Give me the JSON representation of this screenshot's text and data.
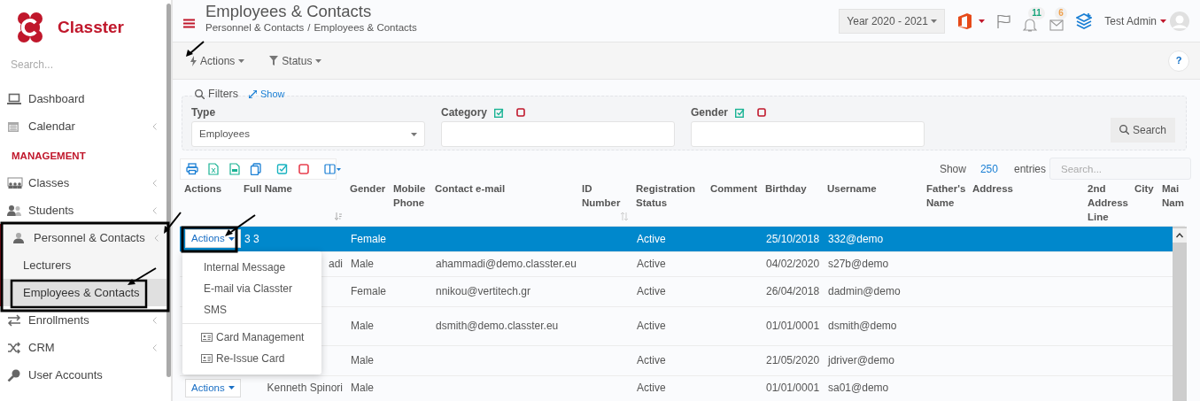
{
  "sidebar": {
    "brand": "Classter",
    "search": {
      "placeholder": "Search..."
    },
    "items": [
      {
        "kind": "link",
        "label": "Dashboard",
        "expandable": false,
        "expanded": false
      },
      {
        "kind": "link",
        "label": "Calendar",
        "expandable": true,
        "expanded": false
      },
      {
        "kind": "heading",
        "label": "MANAGEMENT"
      },
      {
        "kind": "link",
        "label": "Classes",
        "expandable": true,
        "expanded": false
      },
      {
        "kind": "link",
        "label": "Students",
        "expandable": true,
        "expanded": false
      },
      {
        "kind": "link",
        "label": "Personnel & Contacts",
        "expandable": true,
        "expanded": true,
        "children": [
          {
            "label": "Lecturers",
            "selected": false
          },
          {
            "label": "Employees & Contacts",
            "selected": true
          }
        ]
      },
      {
        "kind": "link",
        "label": "Enrollments",
        "expandable": true,
        "expanded": false
      },
      {
        "kind": "link",
        "label": "CRM",
        "expandable": true,
        "expanded": false
      },
      {
        "kind": "link",
        "label": "User Accounts",
        "expandable": false,
        "expanded": false
      }
    ]
  },
  "header": {
    "title": "Employees & Contacts",
    "separator": "/",
    "breadcrumb": [
      "Personnel & Contacts",
      "Employees & Contacts"
    ],
    "year": "Year 2020 - 2021",
    "notifications": "11",
    "messages": "6",
    "user": "Test Admin"
  },
  "toolbar": {
    "buttons": [
      "Actions",
      "Status"
    ],
    "help": "?"
  },
  "filters": {
    "title": "Filters",
    "toggle": "Show",
    "fields": [
      {
        "kind": "select",
        "label": "Type",
        "value": "Employees"
      },
      {
        "kind": "input",
        "label": "Category"
      },
      {
        "kind": "input",
        "label": "Gender"
      }
    ],
    "search_button": "Search"
  },
  "table": {
    "length": {
      "prefix": "Show",
      "value": "250",
      "suffix": "entries"
    },
    "search": {
      "placeholder": "Search..."
    },
    "columns": [
      {
        "label": "Actions"
      },
      {
        "label": "Full Name",
        "sortable": true,
        "sorted": true
      },
      {
        "label": "Gender"
      },
      {
        "label": "Mobile Phone"
      },
      {
        "label": "Contact e-mail"
      },
      {
        "label": "ID Number",
        "sortable": true,
        "sorted": false
      },
      {
        "label": "Registration Status"
      },
      {
        "label": "Comment"
      },
      {
        "label": "Birthday"
      },
      {
        "label": "Username"
      },
      {
        "label": "Father's Name"
      },
      {
        "label": "Address"
      },
      {
        "label": "2nd Address Line"
      },
      {
        "label": "City"
      },
      {
        "label": "Mai Nam"
      }
    ],
    "rows": [
      {
        "selected": true,
        "action": "Actions",
        "full_name": "3 3",
        "gender": "Female",
        "status": "Active",
        "birthday": "25/10/2018",
        "username": "332@demo"
      },
      {
        "selected": false,
        "full_name": "adi",
        "gender": "Male",
        "email": "ahammadi@demo.classter.eu",
        "status": "Active",
        "birthday": "04/02/2020",
        "username": "s27b@demo"
      },
      {
        "selected": false,
        "gender": "Female",
        "email": "nnikou@vertitech.gr",
        "status": "Active",
        "birthday": "26/04/2018",
        "username": "dadmin@demo"
      },
      {
        "selected": false,
        "gender": "Male",
        "email": "dsmith@demo.classter.eu",
        "status": "Active",
        "birthday": "01/01/0001",
        "username": "dsmith@demo"
      },
      {
        "selected": false,
        "gender": "Male",
        "status": "Active",
        "birthday": "21/05/2020",
        "username": "jdriver@demo"
      },
      {
        "selected": false,
        "action": "Actions",
        "full_name": "Kenneth Spinori",
        "gender": "Male",
        "status": "Active",
        "birthday": "01/01/0001",
        "username": "sa01@demo"
      }
    ],
    "row_menu": {
      "open": true,
      "items": [
        {
          "kind": "text",
          "label": "Internal Message"
        },
        {
          "kind": "text",
          "label": "E-mail via Classter"
        },
        {
          "kind": "text",
          "label": "SMS"
        },
        {
          "kind": "card",
          "label": "Card Management"
        },
        {
          "kind": "card",
          "label": "Re-Issue Card"
        }
      ]
    }
  }
}
